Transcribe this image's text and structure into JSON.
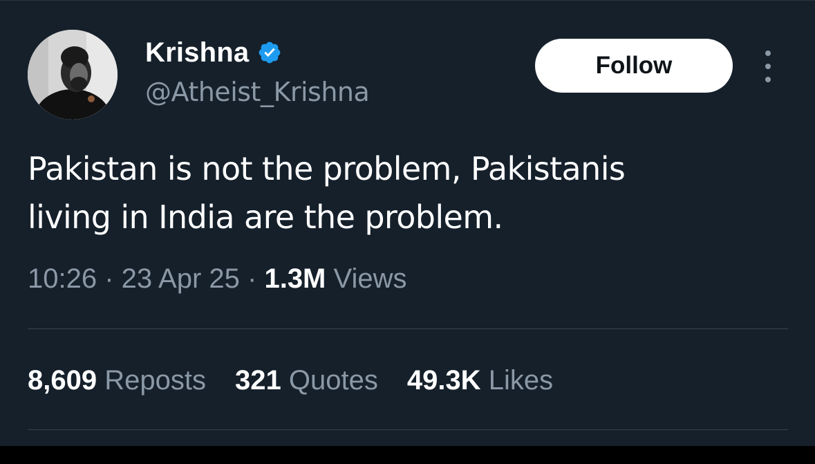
{
  "user": {
    "display_name": "Krishna",
    "handle": "@Atheist_Krishna",
    "verified_icon": "verified-badge-icon",
    "verified_color": "#1d9bf0"
  },
  "actions": {
    "follow_label": "Follow",
    "more_icon": "more-options-icon"
  },
  "tweet": {
    "line1": "Pakistan is not the problem, Pakistanis",
    "line2": "living in India are the problem."
  },
  "meta": {
    "time": "10:26",
    "sep1": " · ",
    "date": "23 Apr 25",
    "sep2": " · ",
    "views_count": "1.3M",
    "views_label": "Views"
  },
  "stats": [
    {
      "count": "8,609",
      "label": "Reposts"
    },
    {
      "count": "321",
      "label": "Quotes"
    },
    {
      "count": "49.3K",
      "label": "Likes"
    }
  ],
  "colors": {
    "background": "#15202b",
    "secondary_text": "#8b98a5",
    "divider": "#38444d"
  }
}
